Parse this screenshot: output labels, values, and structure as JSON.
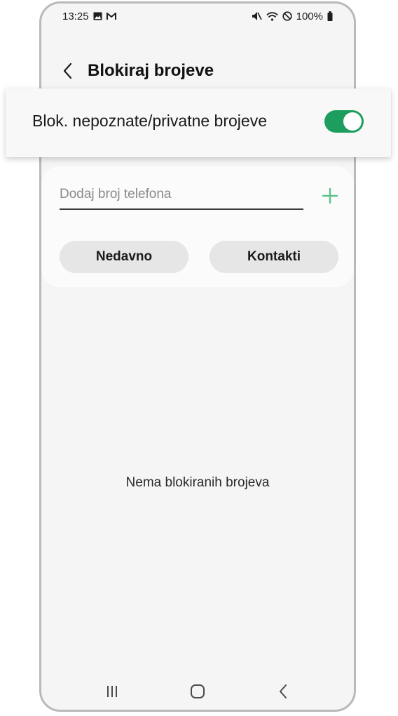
{
  "status_bar": {
    "time": "13:25",
    "battery": "100%",
    "icons_left": [
      "gallery-icon",
      "gmail-icon"
    ],
    "icons_right": [
      "mute-icon",
      "wifi-icon",
      "do-not-disturb-icon",
      "battery-icon"
    ]
  },
  "header": {
    "title": "Blokiraj brojeve"
  },
  "toggle": {
    "label": "Blok. nepoznate/privatne brojeve",
    "state": "on",
    "color": "#1e9e5e"
  },
  "input": {
    "placeholder": "Dodaj broj telefona",
    "value": ""
  },
  "buttons": {
    "recent": "Nedavno",
    "contacts": "Kontakti"
  },
  "empty_state": {
    "text": "Nema blokiranih brojeva"
  },
  "colors": {
    "accent": "#1e9e5e",
    "add_icon": "#5cc48a",
    "background": "#f5f5f5"
  }
}
